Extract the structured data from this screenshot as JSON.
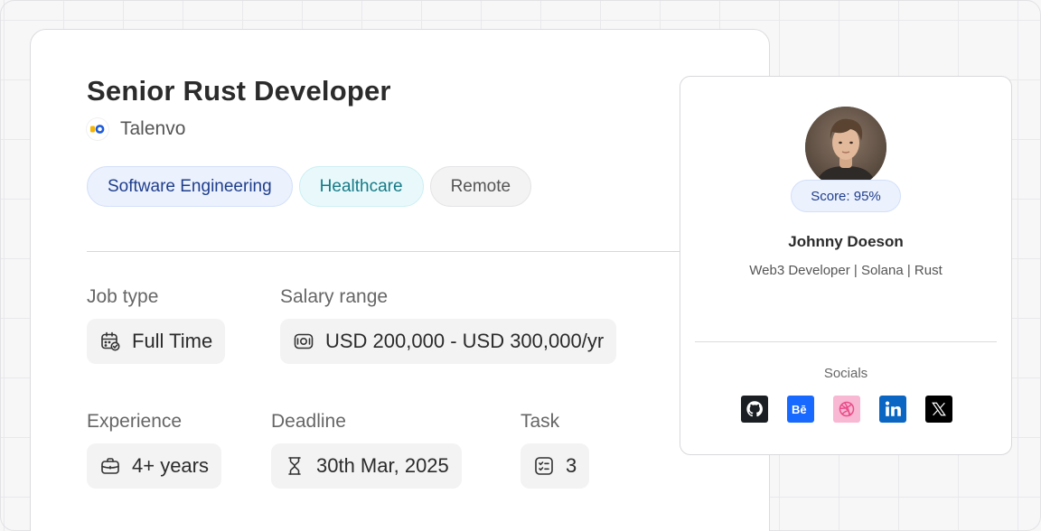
{
  "job": {
    "title": "Senior Rust Developer",
    "company": "Talenvo",
    "tags": [
      "Software Engineering",
      "Healthcare",
      "Remote"
    ],
    "job_type": {
      "label": "Job type",
      "value": "Full Time"
    },
    "salary": {
      "label": "Salary range",
      "value": "USD 200,000 - USD 300,000/yr"
    },
    "experience": {
      "label": "Experience",
      "value": "4+ years"
    },
    "deadline": {
      "label": "Deadline",
      "value": "30th Mar, 2025"
    },
    "task": {
      "label": "Task",
      "value": "3"
    }
  },
  "profile": {
    "score": "Score: 95%",
    "name": "Johnny Doeson",
    "role": "Web3 Developer | Solana | Rust",
    "socials_label": "Socials",
    "socials": [
      {
        "icon": "github-icon",
        "color": "#1b1f23"
      },
      {
        "icon": "behance-icon",
        "color": "#1769ff"
      },
      {
        "icon": "dribbble-icon",
        "color": "#ea4c89"
      },
      {
        "icon": "linkedin-icon",
        "color": "#0a66c2"
      },
      {
        "icon": "x-icon",
        "color": "#000000"
      }
    ]
  },
  "colors": {
    "accent_blue": "#1f3e8c",
    "teal": "#147a87",
    "company_blue": "#1e5bd8",
    "company_yellow": "#f5b400"
  }
}
